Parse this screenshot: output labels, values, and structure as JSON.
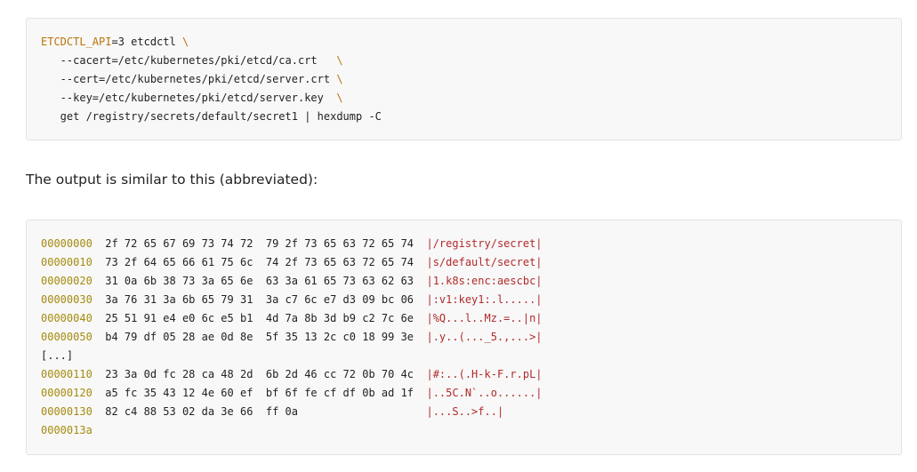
{
  "command": {
    "var": "ETCDCTL_API",
    "var_value": "=3 etcdctl ",
    "backslash": "\\",
    "lines": [
      {
        "text": "   --cacert=/etc/kubernetes/pki/etcd/ca.crt   ",
        "continued": true
      },
      {
        "text": "   --cert=/etc/kubernetes/pki/etcd/server.crt ",
        "continued": true
      },
      {
        "text": "   --key=/etc/kubernetes/pki/etcd/server.key  ",
        "continued": true
      },
      {
        "text": "   get /registry/secrets/default/secret1 | hexdump -C",
        "continued": false
      }
    ]
  },
  "prose": {
    "text": "The output is similar to this (abbreviated):"
  },
  "output": {
    "rows": [
      {
        "addr": "00000000",
        "hex": "  2f 72 65 67 69 73 74 72  79 2f 73 65 63 72 65 74  ",
        "ascii": "|/registry/secret|"
      },
      {
        "addr": "00000010",
        "hex": "  73 2f 64 65 66 61 75 6c  74 2f 73 65 63 72 65 74  ",
        "ascii": "|s/default/secret|"
      },
      {
        "addr": "00000020",
        "hex": "  31 0a 6b 38 73 3a 65 6e  63 3a 61 65 73 63 62 63  ",
        "ascii": "|1.k8s:enc:aescbc|"
      },
      {
        "addr": "00000030",
        "hex": "  3a 76 31 3a 6b 65 79 31  3a c7 6c e7 d3 09 bc 06  ",
        "ascii": "|:v1:key1:.l.....|"
      },
      {
        "addr": "00000040",
        "hex": "  25 51 91 e4 e0 6c e5 b1  4d 7a 8b 3d b9 c2 7c 6e  ",
        "ascii": "|%Q...l..Mz.=..|n|"
      },
      {
        "addr": "00000050",
        "hex": "  b4 79 df 05 28 ae 0d 8e  5f 35 13 2c c0 18 99 3e  ",
        "ascii": "|.y..(..._5.,...>|"
      },
      {
        "addr": "",
        "hex": "[...]",
        "ascii": ""
      },
      {
        "addr": "00000110",
        "hex": "  23 3a 0d fc 28 ca 48 2d  6b 2d 46 cc 72 0b 70 4c  ",
        "ascii": "|#:..(.H-k-F.r.pL|"
      },
      {
        "addr": "00000120",
        "hex": "  a5 fc 35 43 12 4e 60 ef  bf 6f fe cf df 0b ad 1f  ",
        "ascii": "|..5C.N`..o......|"
      },
      {
        "addr": "00000130",
        "hex": "  82 c4 88 53 02 da 3e 66  ff 0a                    ",
        "ascii": "|...S..>f..|"
      },
      {
        "addr": "0000013a",
        "hex": "",
        "ascii": ""
      }
    ]
  },
  "colors": {
    "code_background": "#f8f8f8",
    "variable": "#b8740b",
    "address": "#a58a0f",
    "ascii": "#b22a2a",
    "text": "#222222"
  }
}
